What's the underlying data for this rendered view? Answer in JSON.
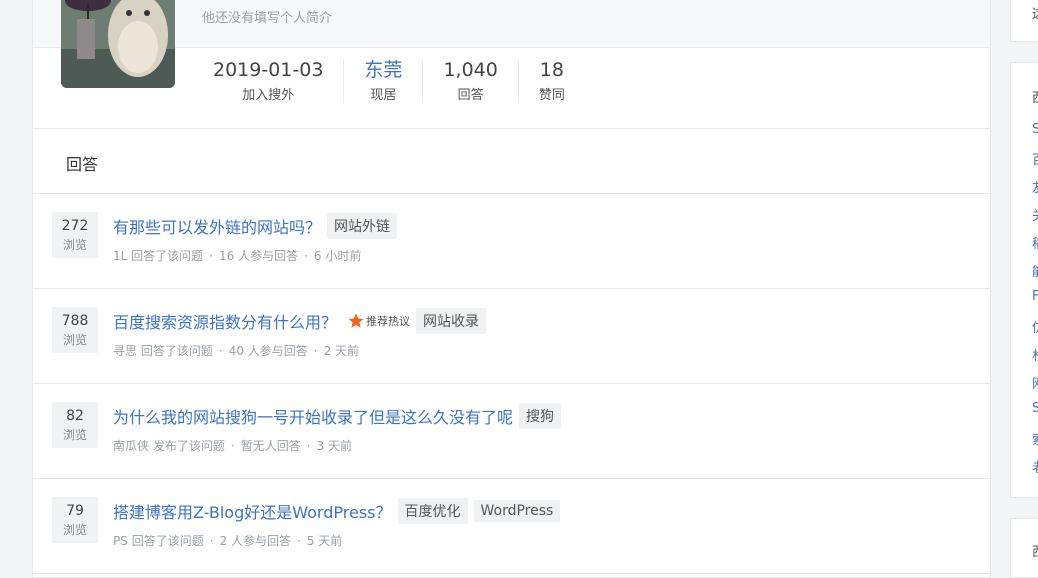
{
  "profile": {
    "bio": "他还没有填写个人简介",
    "stats": [
      {
        "value": "2019-01-03",
        "label": "加入搜外",
        "link": false
      },
      {
        "value": "东莞",
        "label": "现居",
        "link": true
      },
      {
        "value": "1,040",
        "label": "回答",
        "link": false
      },
      {
        "value": "18",
        "label": "赞同",
        "link": false
      }
    ]
  },
  "section": {
    "title": "回答"
  },
  "items": [
    {
      "views": "272",
      "views_label": "浏览",
      "title": "有那些可以发外链的网站吗？",
      "hot": null,
      "tags": [
        "网站外链"
      ],
      "meta": {
        "user": "1L",
        "action": "回答了该问题",
        "count": "16 人参与回答",
        "time": "6 小时前"
      }
    },
    {
      "views": "788",
      "views_label": "浏览",
      "title": "百度搜索资源指数分有什么用？",
      "hot": "推荐热议",
      "tags": [
        "网站收录"
      ],
      "meta": {
        "user": "寻思",
        "action": "回答了该问题",
        "count": "40 人参与回答",
        "time": "2 天前"
      }
    },
    {
      "views": "82",
      "views_label": "浏览",
      "title": "为什么我的网站搜狗一号开始收录了但是这么久没有了呢",
      "hot": null,
      "tags": [
        "搜狗"
      ],
      "meta": {
        "user": "南瓜侠",
        "action": "发布了该问题",
        "count": "暂无人回答",
        "time": "3 天前"
      }
    },
    {
      "views": "79",
      "views_label": "浏览",
      "title": "搭建博客用Z-Blog好还是WordPress？",
      "hot": null,
      "tags": [
        "百度优化",
        "WordPress"
      ],
      "meta": {
        "user": "PS",
        "action": "回答了该问题",
        "count": "2 人参与回答",
        "time": "5 天前"
      }
    }
  ],
  "sidebar": {
    "card1_chars": [
      "这"
    ],
    "card2_chars": [
      "西",
      "S",
      "百",
      "友",
      "关",
      "稻",
      "能",
      "F",
      "仿",
      "杉",
      "网",
      "S",
      "索",
      "老"
    ],
    "card3_chars": [
      "西"
    ]
  },
  "colors": {
    "link": "#3c73c8",
    "hot_star": "#f0661e",
    "meta": "#9aa0a6"
  }
}
